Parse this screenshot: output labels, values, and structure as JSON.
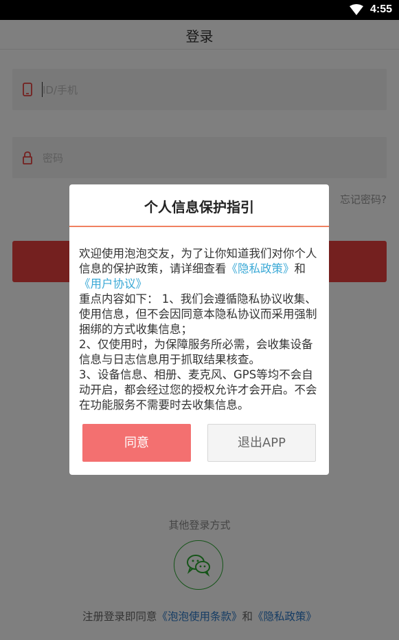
{
  "status_bar": {
    "time": "4:55"
  },
  "header": {
    "title": "登录"
  },
  "login_form": {
    "id_placeholder": "ID/手机",
    "password_placeholder": "密码",
    "forgot_password": "忘记密码?"
  },
  "other_login": {
    "label": "其他登录方式"
  },
  "terms": {
    "prefix": "注册登录即同意",
    "terms_link": "《泡泡使用条款》",
    "and": "和",
    "privacy_link": "《隐私政策》"
  },
  "dialog": {
    "title": "个人信息保护指引",
    "intro": "欢迎使用泡泡交友，为了让你知道我们对你个人信息的保护政策，请详细查看",
    "privacy_link": "《隐私政策》",
    "and": "和",
    "agreement_link": "《用户协议》",
    "point1": "重点内容如下： 1、我们会遵循隐私协议收集、使用信息，但不会因同意本隐私协议而采用强制捆绑的方式收集信息；",
    "point2": " 2、仅使用时，为保障服务所必需，会收集设备信息与日志信息用于抓取结果核查。",
    "point3": " 3、设备信息、相册、麦克风、GPS等均不会自动开启，都会经过您的授权允许才会开启。不会在功能服务不需要时去收集信息。",
    "agree_button": "同意",
    "exit_button": "退出APP"
  },
  "colors": {
    "login_button": "#e8413f",
    "agree_button": "#f37070",
    "link_blue": "#3ba9d6",
    "wechat_green": "#2aa830"
  }
}
